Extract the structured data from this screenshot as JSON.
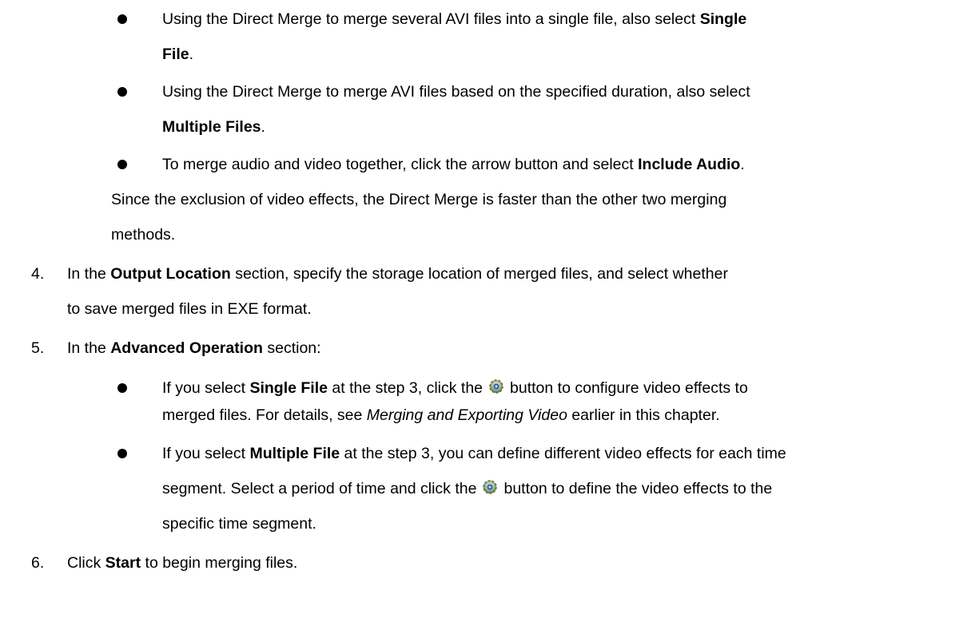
{
  "b1": {
    "l1_pre": "Using the Direct Merge to merge several AVI files into a single file, also select ",
    "l1_bold": "Single",
    "l2_bold": "File",
    "l2_post": "."
  },
  "b2": {
    "l1": "Using the Direct Merge to merge AVI files based on the specified duration, also select",
    "l2_bold": "Multiple Files",
    "l2_post": "."
  },
  "b3": {
    "l1_pre": "To merge audio and video together, click the arrow button and select ",
    "l1_bold": "Include Audio",
    "l1_post": ".",
    "l2": "Since the exclusion of video effects, the Direct Merge is faster than the other two merging",
    "l3": "methods."
  },
  "step4": {
    "num": "4.",
    "l1_pre": "In the ",
    "l1_bold": "Output Location",
    "l1_post": " section, specify the storage location of merged files, and select whether",
    "l2": "to save merged files in EXE format."
  },
  "step5": {
    "num": "5.",
    "pre": "In the ",
    "bold": "Advanced Operation",
    "post": " section:"
  },
  "b4": {
    "l1_pre": "If you select ",
    "l1_bold": "Single File",
    "l1_mid": " at the step 3, click the",
    "l1_post": "button to configure video effects to",
    "l2_pre": "merged files. For details, see ",
    "l2_italic": "Merging and Exporting Video",
    "l2_post": " earlier in this chapter."
  },
  "b5": {
    "l1_pre": "If you select ",
    "l1_bold": "Multiple File",
    "l1_post": " at the step 3, you can define different video effects for each time",
    "l2_pre": "segment. Select a period of time and click the",
    "l2_post": "button to define the video effects to the",
    "l3": "specific time segment."
  },
  "step6": {
    "num": "6.",
    "pre": "Click ",
    "bold": "Start",
    "post": " to begin merging files."
  },
  "icons": {
    "settings": "gear-settings-icon"
  }
}
